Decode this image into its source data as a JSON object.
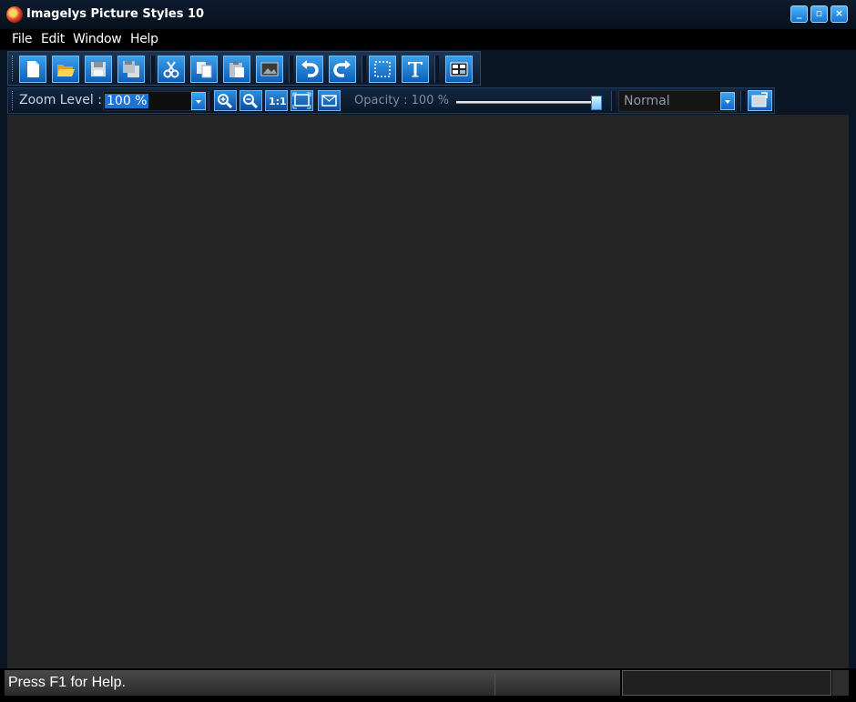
{
  "window": {
    "title": "Imagelys Picture Styles 10"
  },
  "window_controls": [
    "minimize",
    "maximize",
    "close"
  ],
  "menu": [
    "File",
    "Edit",
    "Window",
    "Help"
  ],
  "toolbar": {
    "buttons": [
      "new-file",
      "open-folder",
      "save",
      "save-all",
      "cut",
      "copy",
      "paste",
      "insert-image",
      "undo",
      "redo",
      "select-rectangle",
      "text-tool",
      "layout-view"
    ]
  },
  "view_toolbar": {
    "zoom_label": "Zoom Level :",
    "zoom_value": "100 %",
    "zoom_buttons": [
      "zoom-in",
      "zoom-out",
      "actual-size",
      "fit-to-window",
      "fit-width"
    ],
    "actual_size_label": "1:1",
    "opacity_label": "Opacity : 100 %",
    "opacity_value": 1.0,
    "blend_mode": "Normal"
  },
  "status": {
    "text": "Press F1 for Help."
  },
  "colors": {
    "accent": "#1a74d8",
    "canvas": "#252525",
    "chrome": "#0a1626"
  }
}
